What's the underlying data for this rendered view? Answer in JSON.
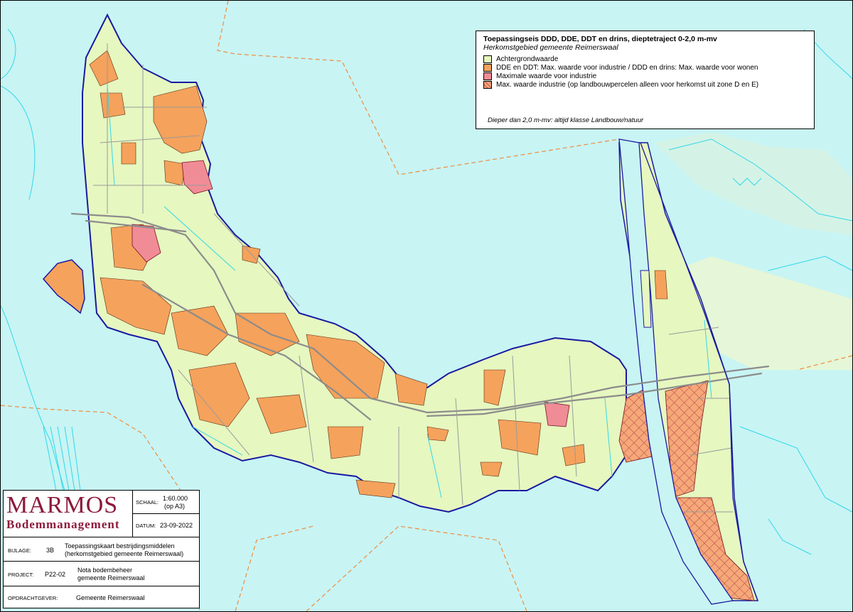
{
  "legend": {
    "title": "Toepassingseis DDD, DDE, DDT en drins, dieptetraject 0-2,0 m-mv",
    "subtitle": "Herkomstgebied gemeente Reimerswaal",
    "items": [
      {
        "label": "Achtergrondwaarde",
        "color": "#e6f7c0"
      },
      {
        "label": "DDE en DDT: Max. waarde voor industrie / DDD en drins: Max. waarde voor wonen",
        "color": "#f5a25c"
      },
      {
        "label": "Maximale waarde voor industrie",
        "color": "#f08c96"
      },
      {
        "label": "Max. waarde industrie (op landbouwpercelen alleen voor herkomst uit zone D en E)",
        "color": "#f5a878"
      }
    ],
    "note": "Dieper dan 2,0 m-mv: altijd klasse Landbouw/natuur"
  },
  "titleblock": {
    "logo_main": "MARMOS",
    "logo_sub": "Bodemmanagement",
    "schaal_label": "SCHAAL:",
    "schaal_value": "1:60.000",
    "schaal_note": "(op A3)",
    "datum_label": "DATUM:",
    "datum_value": "23-09-2022",
    "bijlage_label": "BIJLAGE:",
    "bijlage_number": "3B",
    "bijlage_text_1": "Toepassingskaart bestrijdingsmiddelen",
    "bijlage_text_2": "(herkomstgebied gemeente Reimerswaal)",
    "project_label": "PROJECT:",
    "project_number": "P22-02",
    "project_text_1": "Nota bodembeheer",
    "project_text_2": "gemeente Reimerswaal",
    "opdrachtgever_label": "OPDRACHTGEVER:",
    "opdrachtgever_value": "Gemeente Reimerswaal"
  },
  "colors": {
    "water": "#c8f4f4",
    "land": "#e6f7c0",
    "orange": "#f5a25c",
    "pink": "#f08c96",
    "hatch": "#f5a878",
    "boundary": "#1a1aa0",
    "dashed": "#f08c3c",
    "road": "#8c8c8c",
    "ditch": "#30d8e8"
  }
}
